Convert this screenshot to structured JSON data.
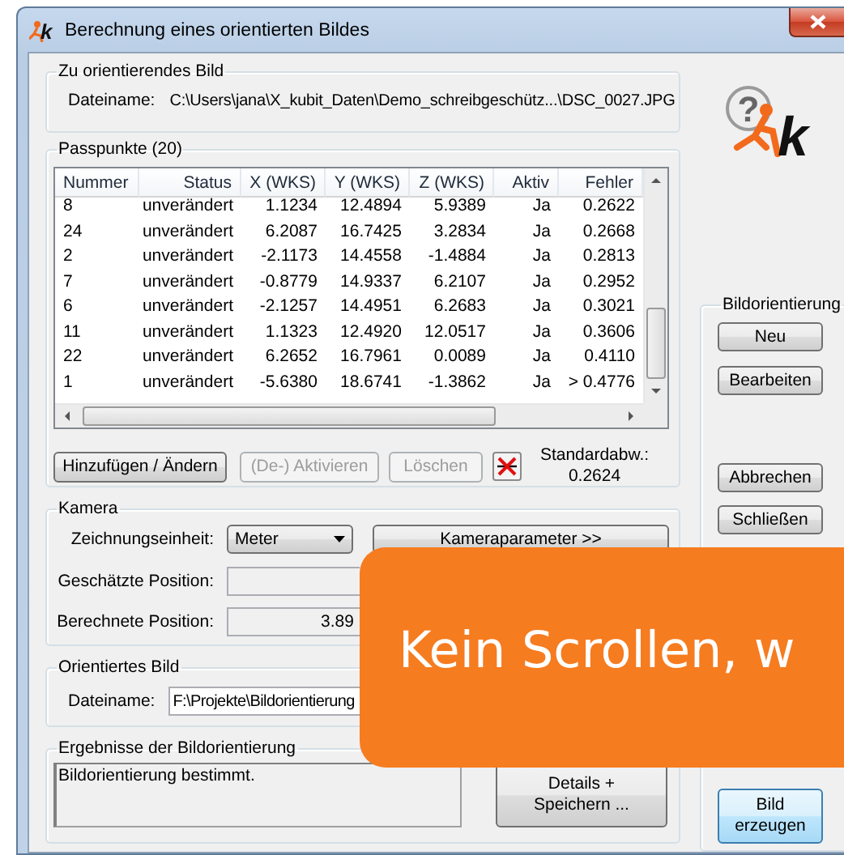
{
  "window": {
    "title": "Berechnung eines orientierten Bildes",
    "icon_letter": "k"
  },
  "logo": {
    "mark": "?",
    "letter": "k"
  },
  "source_image": {
    "label": "Zu orientierendes Bild",
    "filename_label": "Dateiname:",
    "filename": "C:\\Users\\jana\\X_kubit_Daten\\Demo_schreibgeschütz...\\DSC_0027.JPG"
  },
  "control_points": {
    "label": "Passpunkte (20)",
    "columns": [
      "Nummer",
      "Status",
      "X (WKS)",
      "Y (WKS)",
      "Z (WKS)",
      "Aktiv",
      "Fehler"
    ],
    "rows": [
      [
        "8",
        "unverändert",
        "1.1234",
        "12.4894",
        "5.9389",
        "Ja",
        "0.2622"
      ],
      [
        "24",
        "unverändert",
        "6.2087",
        "16.7425",
        "3.2834",
        "Ja",
        "0.2668"
      ],
      [
        "2",
        "unverändert",
        "-2.1173",
        "14.4558",
        "-1.4884",
        "Ja",
        "0.2813"
      ],
      [
        "7",
        "unverändert",
        "-0.8779",
        "14.9337",
        "6.2107",
        "Ja",
        "0.2952"
      ],
      [
        "6",
        "unverändert",
        "-2.1257",
        "14.4951",
        "6.2683",
        "Ja",
        "0.3021"
      ],
      [
        "11",
        "unverändert",
        "1.1323",
        "12.4920",
        "12.0517",
        "Ja",
        "0.3606"
      ],
      [
        "22",
        "unverändert",
        "6.2652",
        "16.7961",
        "0.0089",
        "Ja",
        "0.4110"
      ],
      [
        "1",
        "unverändert",
        "-5.6380",
        "18.6741",
        "-1.3862",
        "Ja",
        "> 0.4776"
      ]
    ],
    "buttons": [
      {
        "label": "Hinzufügen / Ändern",
        "disabled": false
      },
      {
        "label": "(De-) Aktivieren",
        "disabled": true
      },
      {
        "label": "Löschen",
        "disabled": true
      }
    ],
    "std_dev_label": "Standardabw.:",
    "std_dev": "0.2624"
  },
  "camera": {
    "label": "Kamera",
    "unit_label": "Zeichnungseinheit:",
    "unit": "Meter",
    "parameters_button": "Kameraparameter >>",
    "estimated_label": "Geschätzte Position:",
    "computed_label": "Berechnete Position:",
    "computed_value": "3.89"
  },
  "oriented_image": {
    "label": "Orientiertes Bild",
    "filename_label": "Dateiname:",
    "filename": "F:\\Projekte\\Bildorientierung"
  },
  "results": {
    "label": "Ergebnisse der Bildorientierung",
    "text": "Bildorientierung bestimmt.",
    "button": {
      "label": "Details + Speichern ...",
      "highlighted": false
    }
  },
  "image_orientation": {
    "label": "Bildorientierung",
    "buttons": [
      {
        "label": "Neu"
      },
      {
        "label": "Bearbeiten"
      }
    ],
    "dialog_buttons": [
      {
        "label": "Abbrechen"
      },
      {
        "label": "Schließen"
      }
    ],
    "create_button": {
      "label": "Bild erzeugen",
      "highlighted": true
    }
  },
  "callout": {
    "text": "Kein Scrollen, w"
  }
}
